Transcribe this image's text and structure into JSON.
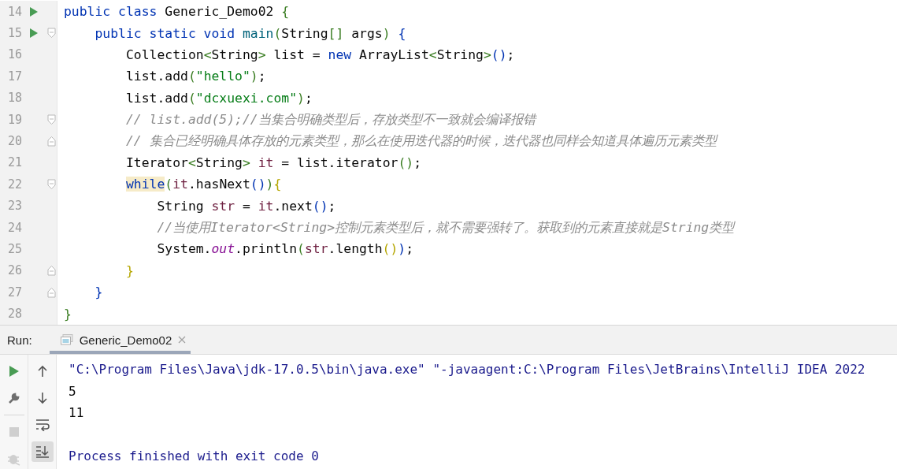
{
  "editor": {
    "lines": [
      {
        "number": "14",
        "run": true,
        "fold_start": false,
        "fold_end": false,
        "tokens": [
          {
            "kind": "kw",
            "text": "public class "
          },
          {
            "kind": "plain",
            "text": "Generic_Demo02 "
          },
          {
            "kind": "punct",
            "text": "{"
          }
        ],
        "children": [
          {
            "number": "15",
            "run": true,
            "fold_start": true,
            "fold_end": false,
            "tokens": [
              {
                "kind": "kw",
                "text": "public static void "
              },
              {
                "kind": "method",
                "text": "main"
              },
              {
                "kind": "punct",
                "text": "("
              },
              {
                "kind": "plain",
                "text": "String"
              },
              {
                "kind": "punct",
                "text": "[] "
              },
              {
                "kind": "plain",
                "text": "args"
              },
              {
                "kind": "punct",
                "text": ") "
              },
              {
                "kind": "kw",
                "text": "{"
              }
            ],
            "children": [
              {
                "number": "16",
                "run": false,
                "fold_start": false,
                "fold_end": false,
                "tokens": [
                  {
                    "kind": "plain",
                    "text": "Collection"
                  },
                  {
                    "kind": "punct",
                    "text": "<"
                  },
                  {
                    "kind": "plain",
                    "text": "String"
                  },
                  {
                    "kind": "punct",
                    "text": "> "
                  },
                  {
                    "kind": "plain",
                    "text": "list = "
                  },
                  {
                    "kind": "kw",
                    "text": "new "
                  },
                  {
                    "kind": "plain",
                    "text": "ArrayList"
                  },
                  {
                    "kind": "punct",
                    "text": "<"
                  },
                  {
                    "kind": "plain",
                    "text": "String"
                  },
                  {
                    "kind": "punct",
                    "text": ">"
                  },
                  {
                    "kind": "kw",
                    "text": "()"
                  },
                  {
                    "kind": "plain",
                    "text": ";"
                  }
                ]
              },
              {
                "number": "17",
                "run": false,
                "fold_start": false,
                "fold_end": false,
                "tokens": [
                  {
                    "kind": "plain",
                    "text": "list.add"
                  },
                  {
                    "kind": "punct",
                    "text": "("
                  },
                  {
                    "kind": "str",
                    "text": "\"hello\""
                  },
                  {
                    "kind": "punct",
                    "text": ")"
                  },
                  {
                    "kind": "plain",
                    "text": ";"
                  }
                ]
              },
              {
                "number": "18",
                "run": false,
                "fold_start": false,
                "fold_end": false,
                "tokens": [
                  {
                    "kind": "plain",
                    "text": "list.add"
                  },
                  {
                    "kind": "punct",
                    "text": "("
                  },
                  {
                    "kind": "str",
                    "text": "\"dcxuexi.com\""
                  },
                  {
                    "kind": "punct",
                    "text": ")"
                  },
                  {
                    "kind": "plain",
                    "text": ";"
                  }
                ]
              },
              {
                "number": "19",
                "run": false,
                "fold_start": true,
                "fold_end": false,
                "tokens": [
                  {
                    "kind": "comment",
                    "text": "// list.add(5);//当集合明确类型后，存放类型不一致就会编译报错"
                  }
                ]
              },
              {
                "number": "20",
                "run": false,
                "fold_start": false,
                "fold_end": true,
                "tokens": [
                  {
                    "kind": "comment",
                    "text": "// 集合已经明确具体存放的元素类型，那么在使用迭代器的时候，迭代器也同样会知道具体遍历元素类型"
                  }
                ]
              },
              {
                "number": "21",
                "run": false,
                "fold_start": false,
                "fold_end": false,
                "tokens": [
                  {
                    "kind": "plain",
                    "text": "Iterator"
                  },
                  {
                    "kind": "punct",
                    "text": "<"
                  },
                  {
                    "kind": "plain",
                    "text": "String"
                  },
                  {
                    "kind": "punct",
                    "text": "> "
                  },
                  {
                    "kind": "var",
                    "text": "it"
                  },
                  {
                    "kind": "plain",
                    "text": " = list.iterator"
                  },
                  {
                    "kind": "punct",
                    "text": "()"
                  },
                  {
                    "kind": "plain",
                    "text": ";"
                  }
                ]
              },
              {
                "number": "22",
                "run": false,
                "fold_start": true,
                "fold_end": false,
                "tokens": [
                  {
                    "kind": "kw",
                    "text": "while",
                    "highlighted": true
                  },
                  {
                    "kind": "punct",
                    "text": "("
                  },
                  {
                    "kind": "var",
                    "text": "it"
                  },
                  {
                    "kind": "plain",
                    "text": ".hasNext"
                  },
                  {
                    "kind": "kw",
                    "text": "()"
                  },
                  {
                    "kind": "punct",
                    "text": ")"
                  },
                  {
                    "kind": "brace",
                    "text": "{"
                  }
                ],
                "children": [
                  {
                    "number": "23",
                    "run": false,
                    "fold_start": false,
                    "fold_end": false,
                    "tokens": [
                      {
                        "kind": "plain",
                        "text": "String "
                      },
                      {
                        "kind": "var",
                        "text": "str"
                      },
                      {
                        "kind": "plain",
                        "text": " = "
                      },
                      {
                        "kind": "var",
                        "text": "it"
                      },
                      {
                        "kind": "plain",
                        "text": ".next"
                      },
                      {
                        "kind": "kw",
                        "text": "()"
                      },
                      {
                        "kind": "plain",
                        "text": ";"
                      }
                    ]
                  },
                  {
                    "number": "24",
                    "run": false,
                    "fold_start": false,
                    "fold_end": false,
                    "tokens": [
                      {
                        "kind": "comment",
                        "text": "//当使用Iterator<String>控制元素类型后，就不需要强转了。获取到的元素直接就是String类型"
                      }
                    ]
                  },
                  {
                    "number": "25",
                    "run": false,
                    "fold_start": false,
                    "fold_end": false,
                    "tokens": [
                      {
                        "kind": "plain",
                        "text": "System."
                      },
                      {
                        "kind": "field",
                        "text": "out"
                      },
                      {
                        "kind": "plain",
                        "text": ".println"
                      },
                      {
                        "kind": "punct",
                        "text": "("
                      },
                      {
                        "kind": "var",
                        "text": "str"
                      },
                      {
                        "kind": "plain",
                        "text": ".length"
                      },
                      {
                        "kind": "brace",
                        "text": "()"
                      },
                      {
                        "kind": "kw",
                        "text": ")"
                      },
                      {
                        "kind": "plain",
                        "text": ";"
                      }
                    ]
                  }
                ]
              },
              {
                "number": "26",
                "run": false,
                "fold_start": false,
                "fold_end": true,
                "tokens": [
                  {
                    "kind": "brace",
                    "text": "}"
                  }
                ]
              }
            ]
          },
          {
            "number": "27",
            "run": false,
            "fold_start": false,
            "fold_end": true,
            "tokens": [
              {
                "kind": "kw",
                "text": "}"
              }
            ]
          }
        ]
      },
      {
        "number": "28",
        "run": false,
        "fold_start": false,
        "fold_end": false,
        "tokens": [
          {
            "kind": "punct",
            "text": "}"
          }
        ]
      }
    ]
  },
  "run_panel": {
    "label": "Run:",
    "tabs": [
      {
        "label": "Generic_Demo02",
        "selected": true,
        "closable": true
      }
    ],
    "toolbar_left": [
      {
        "kind": "run",
        "disabled": false
      },
      {
        "kind": "wrench",
        "disabled": false
      },
      {
        "kind": "stop",
        "disabled": true
      },
      {
        "kind": "bug",
        "disabled": true
      }
    ],
    "toolbar_right": [
      {
        "kind": "up",
        "on": false
      },
      {
        "kind": "down",
        "on": false
      },
      {
        "kind": "wrap",
        "on": false
      },
      {
        "kind": "scroll-end",
        "on": true
      }
    ],
    "console": [
      {
        "kind": "system",
        "text": "\"C:\\Program Files\\Java\\jdk-17.0.5\\bin\\java.exe\" \"-javaagent:C:\\Program Files\\JetBrains\\IntelliJ IDEA 2022"
      },
      {
        "kind": "output",
        "text": "5"
      },
      {
        "kind": "output",
        "text": "11"
      },
      {
        "kind": "system",
        "text": "Process finished with exit code 0",
        "gap_before": true
      }
    ]
  }
}
